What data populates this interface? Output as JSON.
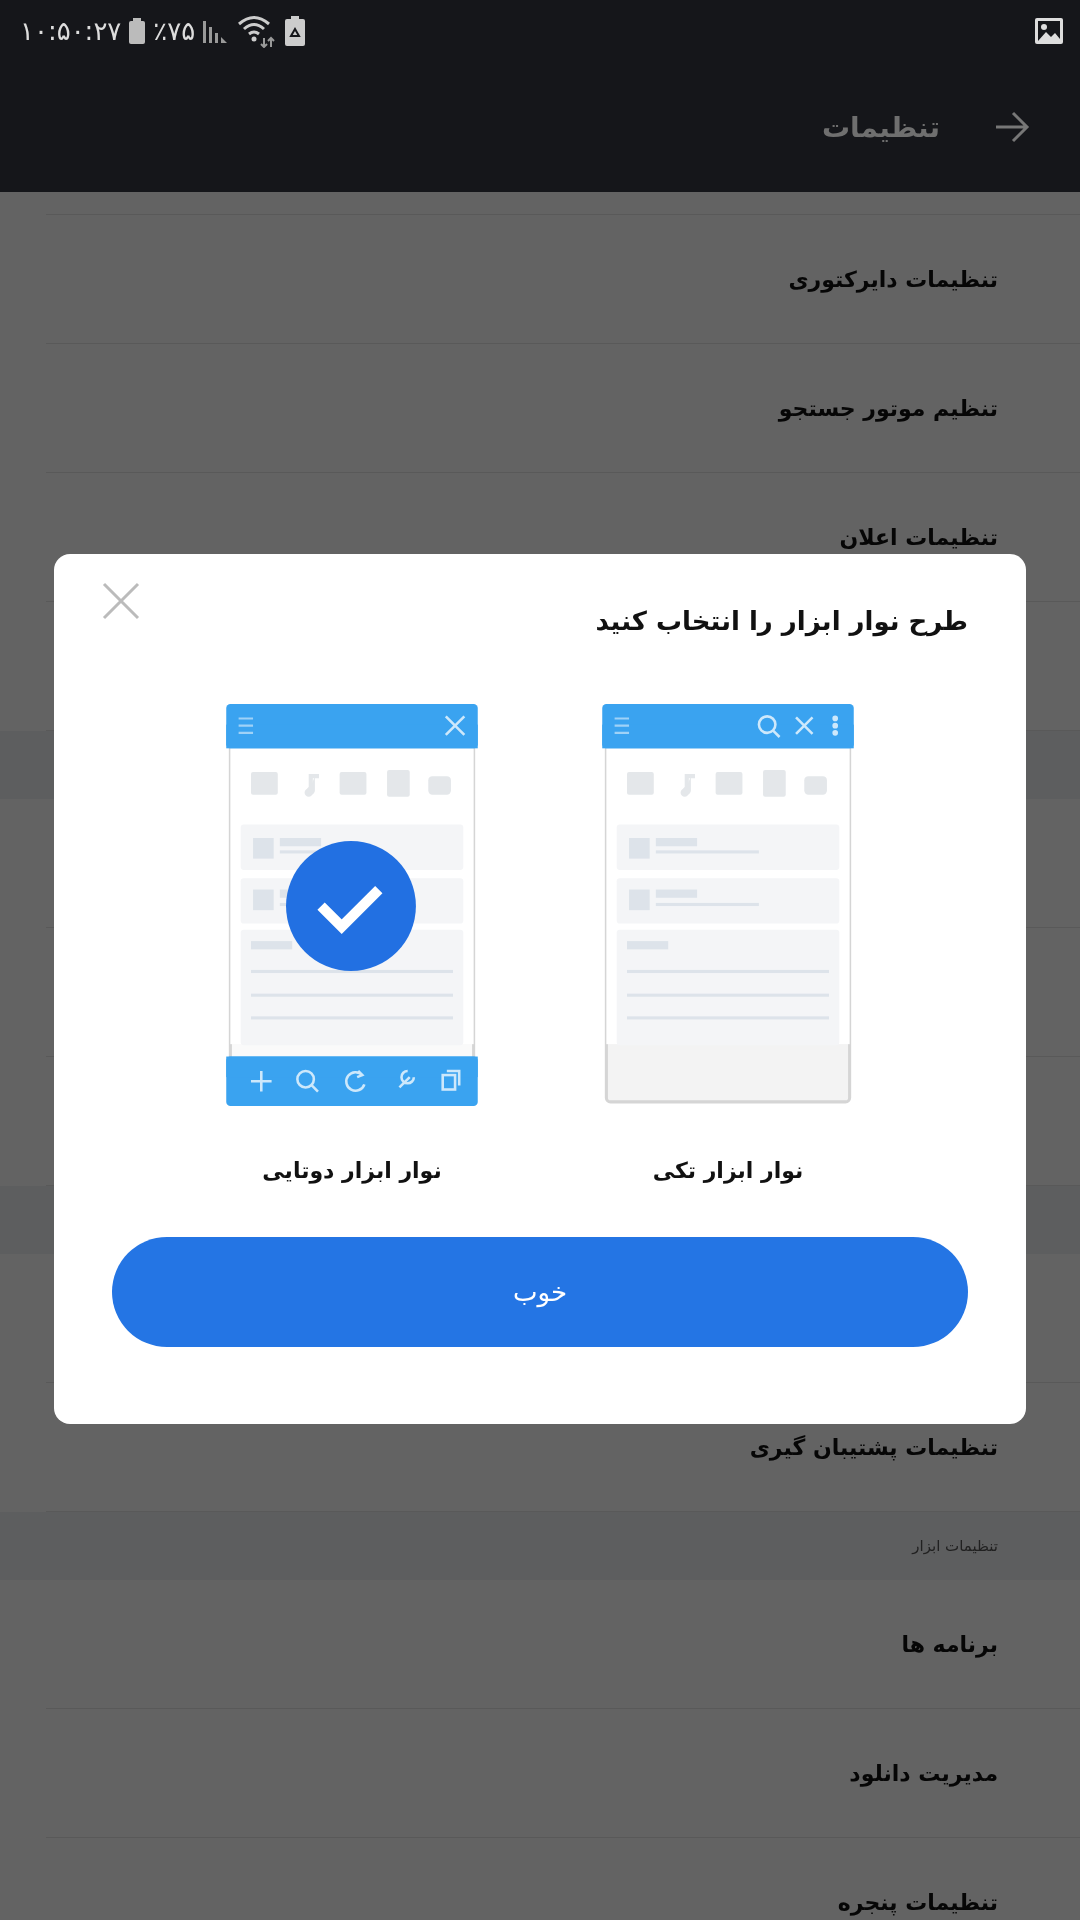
{
  "status_bar": {
    "time": "۱۰:۵۰:۲۷",
    "battery": "٪۷۵"
  },
  "header": {
    "title": "تنظیمات"
  },
  "list": [
    {
      "kind": "item",
      "label": "تنظیمات دایرکتوری"
    },
    {
      "kind": "item",
      "label": "تنظیم موتور جستجو"
    },
    {
      "kind": "item",
      "label": "تنظیمات اعلان"
    },
    {
      "kind": "item"
    },
    {
      "kind": "section"
    },
    {
      "kind": "item"
    },
    {
      "kind": "item"
    },
    {
      "kind": "item"
    },
    {
      "kind": "section"
    },
    {
      "kind": "item"
    },
    {
      "kind": "item",
      "label": "تنظیمات پشتیبان گیری"
    },
    {
      "kind": "section",
      "label": "تنظیمات ابزار"
    },
    {
      "kind": "item",
      "label": "برنامه ها"
    },
    {
      "kind": "item",
      "label": "مدیریت دانلود"
    },
    {
      "kind": "item",
      "label": "تنظیمات پنجره"
    }
  ],
  "dialog": {
    "title": "طرح نوار ابزار را انتخاب کنید",
    "options": [
      {
        "kind": "single",
        "label": "نوار ابزار تکی",
        "selected": false
      },
      {
        "kind": "double",
        "label": "نوار ابزار دوتایی",
        "selected": true
      }
    ],
    "button": "خوب"
  }
}
